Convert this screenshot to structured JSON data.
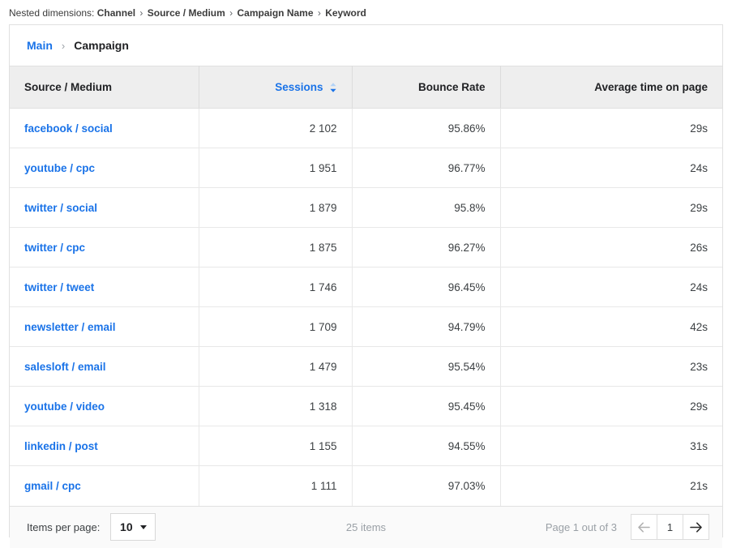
{
  "nested_dimensions": {
    "label": "Nested dimensions:",
    "separator": "›",
    "items": [
      "Channel",
      "Source / Medium",
      "Campaign Name",
      "Keyword"
    ]
  },
  "card": {
    "breadcrumb": {
      "root": "Main",
      "separator": "›",
      "current": "Campaign"
    },
    "table": {
      "columns": [
        {
          "label": "Source / Medium",
          "align": "left",
          "sorted": false
        },
        {
          "label": "Sessions",
          "align": "right",
          "sorted": true,
          "sort_direction": "desc",
          "sort_icon": "sort-arrows-icon"
        },
        {
          "label": "Bounce Rate",
          "align": "right",
          "sorted": false
        },
        {
          "label": "Average time on page",
          "align": "right",
          "sorted": false
        }
      ],
      "rows": [
        {
          "source_medium": "facebook / social",
          "sessions": "2 102",
          "bounce_rate": "95.86%",
          "avg_time": "29s"
        },
        {
          "source_medium": "youtube / cpc",
          "sessions": "1 951",
          "bounce_rate": "96.77%",
          "avg_time": "24s"
        },
        {
          "source_medium": "twitter / social",
          "sessions": "1 879",
          "bounce_rate": "95.8%",
          "avg_time": "29s"
        },
        {
          "source_medium": "twitter / cpc",
          "sessions": "1 875",
          "bounce_rate": "96.27%",
          "avg_time": "26s"
        },
        {
          "source_medium": "twitter / tweet",
          "sessions": "1 746",
          "bounce_rate": "96.45%",
          "avg_time": "24s"
        },
        {
          "source_medium": "newsletter / email",
          "sessions": "1 709",
          "bounce_rate": "94.79%",
          "avg_time": "42s"
        },
        {
          "source_medium": "salesloft / email",
          "sessions": "1 479",
          "bounce_rate": "95.54%",
          "avg_time": "23s"
        },
        {
          "source_medium": "youtube / video",
          "sessions": "1 318",
          "bounce_rate": "95.45%",
          "avg_time": "29s"
        },
        {
          "source_medium": "linkedin / post",
          "sessions": "1 155",
          "bounce_rate": "94.55%",
          "avg_time": "31s"
        },
        {
          "source_medium": "gmail / cpc",
          "sessions": "1 111",
          "bounce_rate": "97.03%",
          "avg_time": "21s"
        }
      ]
    },
    "footer": {
      "items_per_page_label": "Items per page:",
      "items_per_page_value": "10",
      "items_count": "25 items",
      "page_status": "Page 1 out of 3",
      "prev_label": "←",
      "current_page": "1",
      "next_label": "→"
    }
  },
  "colors": {
    "link_blue": "#1a73e8",
    "header_bg": "#eeeeee",
    "footer_bg": "#fafafa",
    "muted_text": "#9aa0a6",
    "border": "#e0e0e0"
  }
}
